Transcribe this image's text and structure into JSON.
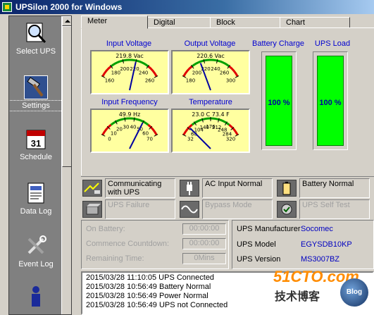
{
  "window": {
    "title": "UPSilon 2000 for Windows"
  },
  "sidebar": {
    "items": [
      {
        "label": "Select UPS",
        "icon": "magnifier-icon"
      },
      {
        "label": "Settings",
        "icon": "hammer-icon"
      },
      {
        "label": "Schedule",
        "icon": "calendar-icon"
      },
      {
        "label": "Data Log",
        "icon": "document-icon"
      },
      {
        "label": "Event Log",
        "icon": "tools-icon"
      }
    ],
    "calendar_day": "31"
  },
  "tabs": [
    "Meter",
    "Digital",
    "Block",
    "Chart"
  ],
  "gauges": [
    {
      "title": "Input Voltage",
      "reading": "219.8 Vac",
      "ticks": [
        "160",
        "180",
        "200",
        "220",
        "240",
        "260"
      ],
      "min": 160,
      "max": 260,
      "value": 219.8
    },
    {
      "title": "Output Voltage",
      "reading": "220.6 Vac",
      "ticks": [
        "180",
        "200",
        "220",
        "240",
        "260",
        "300"
      ],
      "min": 180,
      "max": 300,
      "value": 220.6
    },
    {
      "title": "Input Frequency",
      "reading": "49.9 Hz",
      "ticks": [
        "0",
        "10",
        "20",
        "30",
        "40",
        "50",
        "60",
        "70"
      ],
      "min": 0,
      "max": 70,
      "value": 49.9
    },
    {
      "title": "Temperature",
      "reading": "23.0 C   73.4 F",
      "ticks": [
        "32",
        "68",
        "104",
        "140",
        "176",
        "212",
        "248",
        "284",
        "320"
      ],
      "min": 32,
      "max": 320,
      "value": 73.4
    }
  ],
  "bars": [
    {
      "title": "Battery Charge",
      "percent_text": "100 %",
      "value": 100
    },
    {
      "title": "UPS Load",
      "percent_text": "100 %",
      "value": 100
    }
  ],
  "status": [
    {
      "text": "Communicating with UPS",
      "icon": "cable-icon",
      "active": true
    },
    {
      "text": "AC Input Normal",
      "icon": "plug-icon",
      "active": true
    },
    {
      "text": "Battery Normal",
      "icon": "battery-icon",
      "active": true
    },
    {
      "text": "UPS Failure",
      "icon": "ups-box-icon",
      "active": false
    },
    {
      "text": "Bypass Mode",
      "icon": "wave-icon",
      "active": false
    },
    {
      "text": "UPS Self Test",
      "icon": "checkup-icon",
      "active": false
    }
  ],
  "runtime": [
    {
      "label": "On Battery:",
      "value": "00:00:00"
    },
    {
      "label": "Commence Countdown:",
      "value": "00:00:00"
    },
    {
      "label": "Remaining Time:",
      "value": "0Mins"
    }
  ],
  "ups_info": [
    {
      "label": "UPS Manufacturer",
      "value": "Socomec"
    },
    {
      "label": "UPS Model",
      "value": "EGYSDB10KP"
    },
    {
      "label": "UPS Version",
      "value": "MS3007BZ"
    }
  ],
  "event_log": [
    "2015/03/28 11:10:05  UPS Connected",
    "2015/03/28 10:56:49  Battery Normal",
    "2015/03/28 10:56:49  Power Normal",
    "2015/03/28 10:56:49  UPS not Connected"
  ],
  "watermark": {
    "title": "51CTO.com",
    "subtitle": "技术博客",
    "badge": "Blog"
  },
  "colors": {
    "gauge_face": "#ffffa0",
    "bar_fill": "#00ff00",
    "label_blue": "#0000d0",
    "needle": "#0000a0"
  }
}
